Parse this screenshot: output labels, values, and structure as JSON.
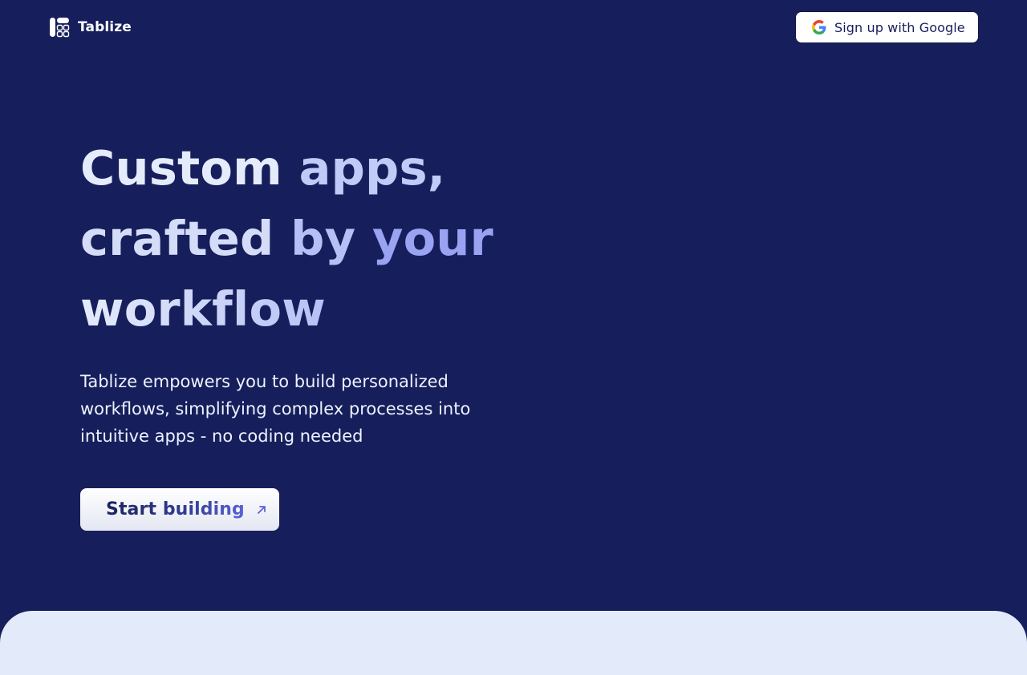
{
  "brand": {
    "name": "Tablize",
    "logo_icon": "tablize-logo-icon"
  },
  "header": {
    "signup_label": "Sign up with Google",
    "signup_icon": "google-icon"
  },
  "hero": {
    "title_parts": [
      "Custom ",
      "apps,",
      "crafted ",
      "by ",
      "your",
      "workflow"
    ],
    "subtitle": "Tablize empowers you to build personalized workflows, simplifying complex processes into intuitive apps - no coding needed",
    "cta_label": "Start building",
    "cta_icon": "arrow-up-right-icon"
  },
  "colors": {
    "background": "#161f5b",
    "panel": "#e3ebfb",
    "accent": "#5a63d6"
  }
}
